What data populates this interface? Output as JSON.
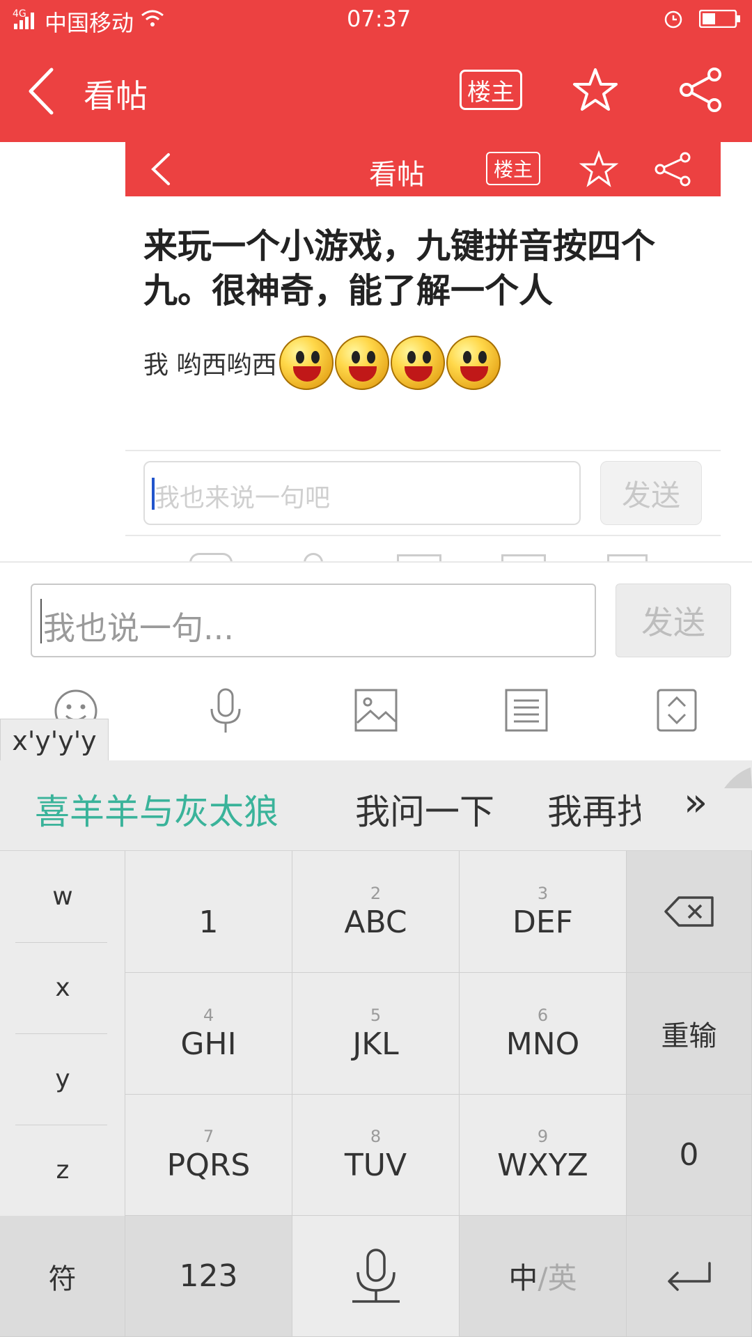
{
  "status_bar": {
    "network": "4G",
    "carrier": "中国移动",
    "time": "07:37"
  },
  "nav": {
    "title": "看帖",
    "owner_label": "楼主",
    "icons": [
      "back-icon",
      "star-icon",
      "share-icon"
    ]
  },
  "embedded_screenshot": {
    "nav_title": "看帖",
    "owner_label": "楼主",
    "post_title": "来玩一个小游戏，九键拼音按四个九。很神奇，能了解一个人",
    "post_body": "我 哟西哟西",
    "emoji_count": 4,
    "input_placeholder": "我也来说一句吧",
    "send_label": "发送"
  },
  "reply_bar": {
    "input_placeholder": "我也说一句...",
    "send_label": "发送",
    "tools": [
      "emoji-icon",
      "microphone-icon",
      "image-icon",
      "list-icon",
      "expand-icon"
    ]
  },
  "keyboard": {
    "composition": "x'y'y'y",
    "candidates": [
      "喜羊羊与灰太狼",
      "我问一下",
      "我再找"
    ],
    "candidate_more": "»",
    "side_letters": [
      "w",
      "x",
      "y",
      "z"
    ],
    "keys": [
      {
        "num": "",
        "letters": "1"
      },
      {
        "num": "2",
        "letters": "ABC"
      },
      {
        "num": "3",
        "letters": "DEF"
      },
      {
        "num": "4",
        "letters": "GHI"
      },
      {
        "num": "5",
        "letters": "JKL"
      },
      {
        "num": "6",
        "letters": "MNO"
      },
      {
        "num": "7",
        "letters": "PQRS"
      },
      {
        "num": "8",
        "letters": "TUV"
      },
      {
        "num": "9",
        "letters": "WXYZ"
      }
    ],
    "reinput_label": "重输",
    "zero_label": "0",
    "symbol_label": "符",
    "num123_label": "123",
    "lang_zh": "中",
    "lang_sep": "/",
    "lang_en": "英",
    "colors": {
      "accent": "#3ab39a",
      "brand_red": "#ec4141"
    }
  }
}
